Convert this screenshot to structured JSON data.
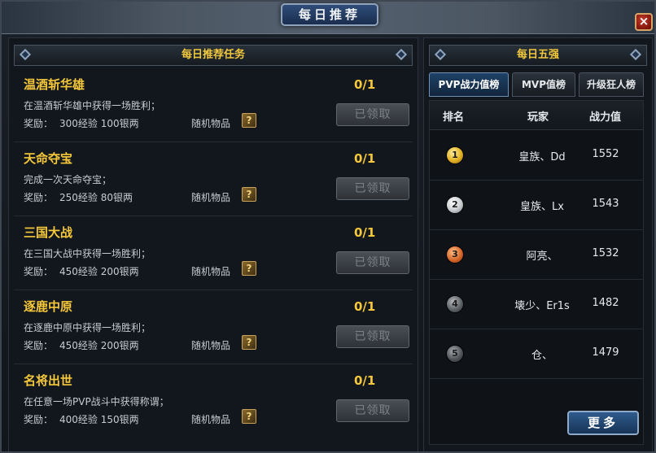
{
  "window": {
    "title": "每日推荐",
    "close_label": "×"
  },
  "tasks_panel": {
    "title": "每日推荐任务",
    "tasks": [
      {
        "title": "温酒斩华雄",
        "progress": "0/1",
        "description": "在温酒斩华雄中获得一场胜利；",
        "reward_label": "奖励：",
        "reward": "300经验 100银两",
        "random_item": "随机物品",
        "item_icon": "?",
        "button": "已领取"
      },
      {
        "title": "天命夺宝",
        "progress": "0/1",
        "description": "完成一次天命夺宝；",
        "reward_label": "奖励：",
        "reward": "250经验 80银两",
        "random_item": "随机物品",
        "item_icon": "?",
        "button": "已领取"
      },
      {
        "title": "三国大战",
        "progress": "0/1",
        "description": "在三国大战中获得一场胜利；",
        "reward_label": "奖励：",
        "reward": "450经验 200银两",
        "random_item": "随机物品",
        "item_icon": "?",
        "button": "已领取"
      },
      {
        "title": "逐鹿中原",
        "progress": "0/1",
        "description": "在逐鹿中原中获得一场胜利；",
        "reward_label": "奖励：",
        "reward": "450经验 200银两",
        "random_item": "随机物品",
        "item_icon": "?",
        "button": "已领取"
      },
      {
        "title": "名将出世",
        "progress": "0/1",
        "description": "在任意一场PVP战斗中获得称谓；",
        "reward_label": "奖励：",
        "reward": "400经验 150银两",
        "random_item": "随机物品",
        "item_icon": "?",
        "button": "已领取"
      }
    ]
  },
  "ranking_panel": {
    "title": "每日五强",
    "tabs": [
      {
        "label": "PVP战力值榜",
        "active": true
      },
      {
        "label": "MVP值榜",
        "active": false
      },
      {
        "label": "升级狂人榜",
        "active": false
      }
    ],
    "columns": {
      "rank": "排名",
      "player": "玩家",
      "power": "战力值"
    },
    "rows": [
      {
        "rank": "1",
        "player": "皇族、Dd",
        "power": "1552"
      },
      {
        "rank": "2",
        "player": "皇族、Lx",
        "power": "1543"
      },
      {
        "rank": "3",
        "player": "阿亮、",
        "power": "1532"
      },
      {
        "rank": "4",
        "player": "壊少、Er1s",
        "power": "1482"
      },
      {
        "rank": "5",
        "player": "仓、",
        "power": "1479"
      }
    ],
    "more_button": "更多"
  }
}
